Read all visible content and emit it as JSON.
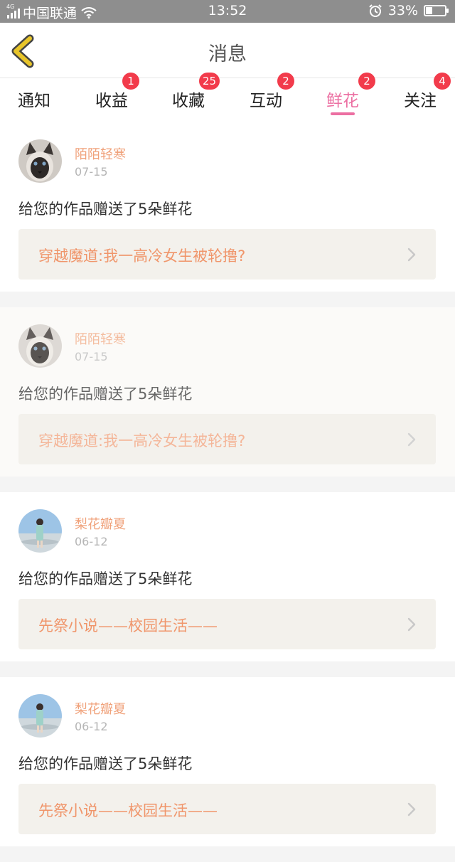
{
  "status_bar": {
    "network": "4G",
    "carrier": "中国联通",
    "time": "13:52",
    "battery_text": "33%",
    "battery_level": 0.33,
    "icons": [
      "signal-icon",
      "wifi-icon",
      "alarm-icon",
      "battery-icon"
    ]
  },
  "header": {
    "title": "消息",
    "back_icon": "chevron-left-icon",
    "accent": "#e8c52a"
  },
  "tabs": [
    {
      "label": "通知",
      "badge": ""
    },
    {
      "label": "收益",
      "badge": "1"
    },
    {
      "label": "收藏",
      "badge": "25"
    },
    {
      "label": "互动",
      "badge": "2"
    },
    {
      "label": "鲜花",
      "badge": "2",
      "active": true
    },
    {
      "label": "关注",
      "badge": "4"
    }
  ],
  "colors": {
    "active_tab": "#ec6fa2",
    "badge": "#f23b4b",
    "user_name": "#f0a27b",
    "work_title": "#f0956a"
  },
  "messages": [
    {
      "user": "陌陌轻寒",
      "date": "07-15",
      "text": "给您的作品赠送了5朵鲜花",
      "work": "穿越魔道:我一高冷女生被轮撸?",
      "avatar": "siamese-cat",
      "read": false
    },
    {
      "user": "陌陌轻寒",
      "date": "07-15",
      "text": "给您的作品赠送了5朵鲜花",
      "work": "穿越魔道:我一高冷女生被轮撸?",
      "avatar": "siamese-cat",
      "read": true
    },
    {
      "user": "梨花瓣夏",
      "date": "06-12",
      "text": "给您的作品赠送了5朵鲜花",
      "work": "先祭小说——校园生活——",
      "avatar": "girl-photo",
      "read": false
    },
    {
      "user": "梨花瓣夏",
      "date": "06-12",
      "text": "给您的作品赠送了5朵鲜花",
      "work": "先祭小说——校园生活——",
      "avatar": "girl-photo",
      "read": false
    }
  ]
}
